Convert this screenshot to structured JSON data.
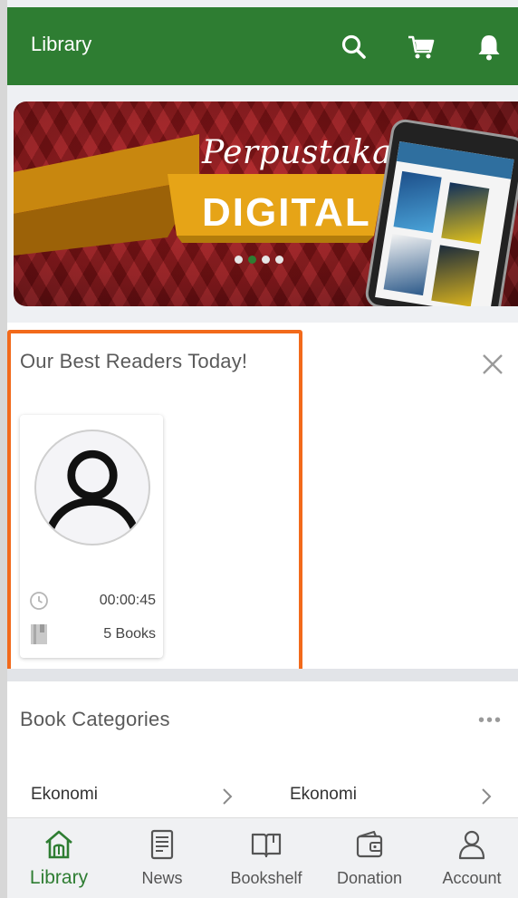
{
  "header": {
    "title": "Library",
    "actions": [
      "search-icon",
      "cart-icon",
      "bell-icon"
    ]
  },
  "banner": {
    "script_text": "Perpustakaan",
    "main_text": "DIGITAL",
    "slide_count": 4,
    "active_slide": 2
  },
  "best_readers": {
    "title": "Our Best Readers Today!",
    "readers": [
      {
        "time": "00:00:45",
        "books": "5 Books"
      }
    ]
  },
  "categories": {
    "title": "Book Categories",
    "more_label": "•••",
    "items": [
      {
        "label": "Ekonomi"
      },
      {
        "label": "Ekonomi"
      }
    ]
  },
  "bottom_nav": {
    "items": [
      {
        "label": "Library",
        "icon": "home-icon",
        "active": true
      },
      {
        "label": "News",
        "icon": "news-icon",
        "active": false
      },
      {
        "label": "Bookshelf",
        "icon": "book-open-icon",
        "active": false
      },
      {
        "label": "Donation",
        "icon": "wallet-icon",
        "active": false
      },
      {
        "label": "Account",
        "icon": "user-icon",
        "active": false
      }
    ]
  },
  "colors": {
    "primary": "#2e7d32",
    "highlight_outline": "#f26a1b",
    "banner_red": "#a31a1e",
    "banner_gold": "#e6a417"
  }
}
